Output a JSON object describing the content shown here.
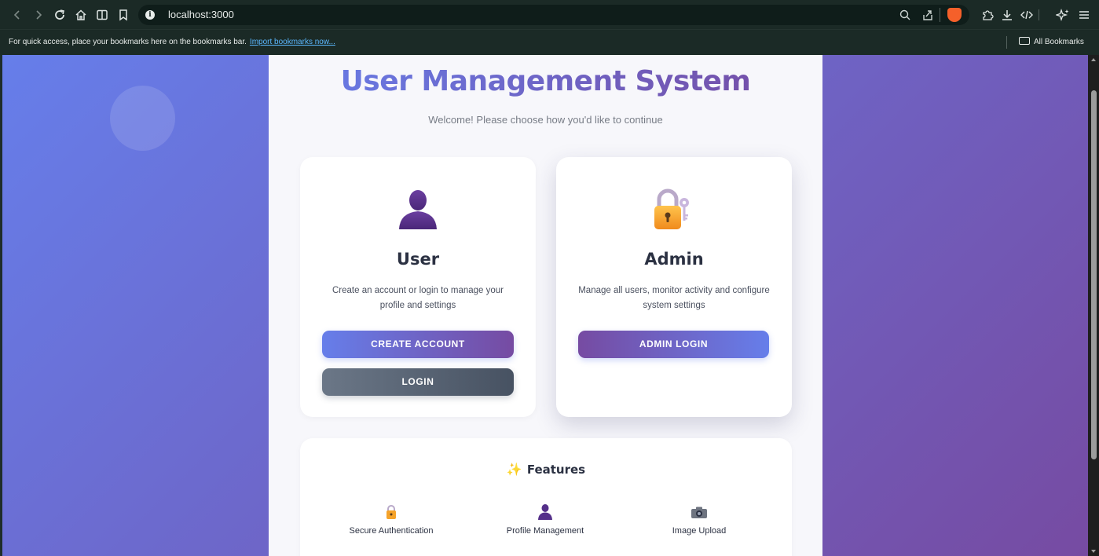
{
  "browser": {
    "url": "localhost:3000",
    "bookmarks_message": "For quick access, place your bookmarks here on the bookmarks bar.",
    "import_link": "Import bookmarks now...",
    "all_bookmarks": "All Bookmarks"
  },
  "page": {
    "title": "User Management System",
    "subtitle": "Welcome! Please choose how you'd like to continue"
  },
  "cards": {
    "user": {
      "icon": "person-icon",
      "title": "User",
      "description": "Create an account or login to manage your profile and settings",
      "create_label": "CREATE ACCOUNT",
      "login_label": "LOGIN"
    },
    "admin": {
      "icon": "lock-with-key-icon",
      "title": "Admin",
      "description": "Manage all users, monitor activity and configure system settings",
      "login_label": "ADMIN LOGIN"
    }
  },
  "features": {
    "title": "Features",
    "items": [
      {
        "icon": "lock-icon",
        "label": "Secure Authentication"
      },
      {
        "icon": "person-icon",
        "label": "Profile Management"
      },
      {
        "icon": "camera-icon",
        "label": "Image Upload"
      }
    ]
  },
  "colors": {
    "gradient_start": "#667eea",
    "gradient_end": "#764ba2",
    "browser_chrome": "#1b2a26"
  }
}
